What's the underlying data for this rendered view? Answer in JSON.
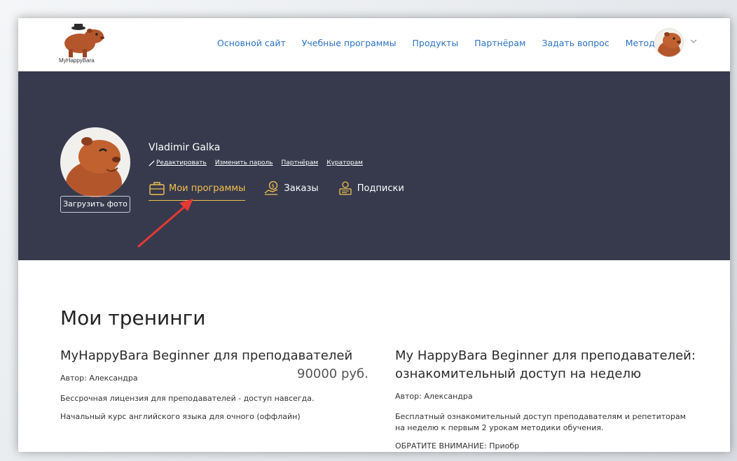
{
  "header": {
    "logo_text": "MyHappyBara",
    "nav": [
      "Основной сайт",
      "Учебные программы",
      "Продукты",
      "Партнёрам",
      "Задать вопрос",
      "Методика"
    ]
  },
  "profile": {
    "name": "Vladimir Galka",
    "upload_label": "Загрузить фото",
    "links": [
      "Редактировать",
      "Изменить пароль",
      "Партнёрам",
      "Кураторам"
    ],
    "tabs": [
      {
        "label": "Мои программы",
        "icon": "briefcase-icon",
        "active": true
      },
      {
        "label": "Заказы",
        "icon": "money-hand-icon",
        "active": false
      },
      {
        "label": "Подписки",
        "icon": "user-card-icon",
        "active": false
      }
    ]
  },
  "main": {
    "title": "Мои тренинги",
    "courses": [
      {
        "title": "MyHappyBara Beginner для преподавателей",
        "price": "90000 руб.",
        "author": "Автор: Александра",
        "description": "Бессрочная лицензия для преподавателей - доступ навсегда.",
        "description2": "Начальный курс английского языка для очного (оффлайн)"
      },
      {
        "title": "My HappyBara Beginner для преподавателей: ознакомительный доступ на неделю",
        "price": "",
        "author": "Автор: Александра",
        "description": "Бесплатный ознакомительный доступ преподавателям и репетиторам на неделю к первым 2 урокам методики обучения.",
        "description2": "ОБРАТИТЕ ВНИМАНИЕ: Приобр"
      }
    ]
  },
  "colors": {
    "hero_bg": "#373a4d",
    "accent": "#f2c14e",
    "nav_link": "#2d72c4",
    "arrow": "#e53935",
    "capybara": "#b4562b"
  }
}
